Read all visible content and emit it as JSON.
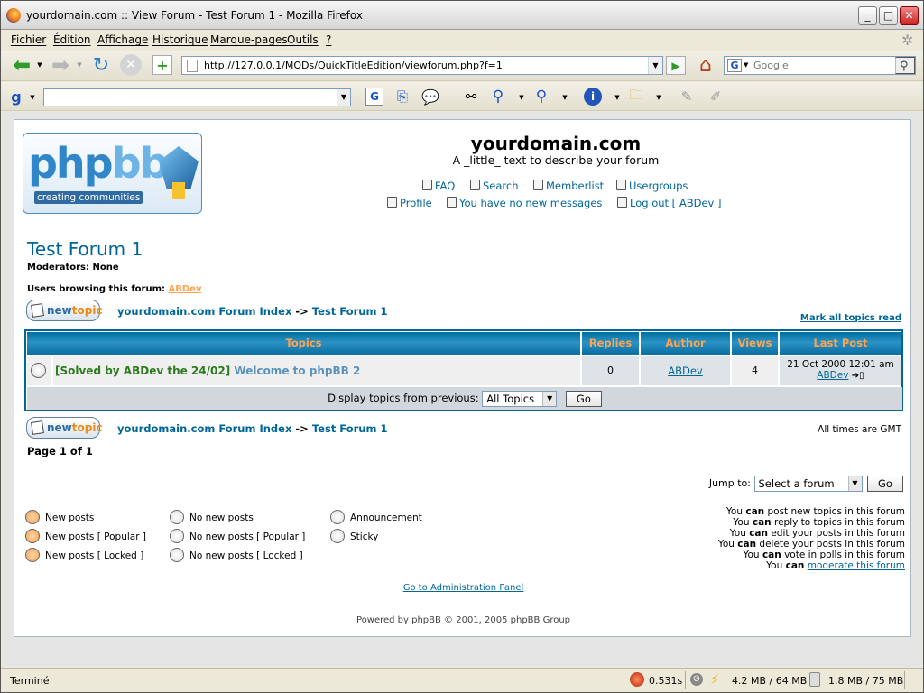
{
  "window": {
    "title": "yourdomain.com :: View Forum - Test Forum 1 - Mozilla Firefox",
    "controls": [
      "_",
      "□",
      "✕"
    ]
  },
  "menu": [
    "Fichier",
    "Édition",
    "Affichage",
    "Historique",
    "Marque-pages",
    "Outils",
    "?"
  ],
  "navbar": {
    "url": "http://127.0.0.1/MODs/QuickTitleEdition/viewforum.php?f=1",
    "search_placeholder": "Google"
  },
  "header": {
    "logo_text_dark": "php",
    "logo_text_light": "bb",
    "logo_tagline": "creating  communities",
    "site_name": "yourdomain.com",
    "site_desc": "A _little_ text to describe your forum",
    "links_row1": [
      "FAQ",
      "Search",
      "Memberlist",
      "Usergroups"
    ],
    "links_row2": [
      "Profile",
      "You have no new messages",
      "Log out [ ABDev ]"
    ]
  },
  "forum": {
    "title": "Test Forum 1",
    "moderators_label": "Moderators: None",
    "browsing_label": "Users browsing this forum:",
    "browsing_user": "ABDev",
    "newtopic_a": "new",
    "newtopic_b": "topic",
    "crumb_index": "yourdomain.com Forum Index",
    "crumb_sep": "->",
    "crumb_forum": "Test Forum 1",
    "mark_read": "Mark all topics read",
    "all_times": "All times are GMT",
    "page_info": "Page 1 of 1"
  },
  "table": {
    "headers": [
      "Topics",
      "Replies",
      "Author",
      "Views",
      "Last Post"
    ],
    "rows": [
      {
        "prefix": "[Solved by ABDev the 24/02]",
        "title": "Welcome to phpBB 2",
        "replies": "0",
        "author": "ABDev",
        "views": "4",
        "last_post_date": "21 Oct 2000 12:01 am",
        "last_post_user": "ABDev"
      }
    ],
    "display_label": "Display topics from previous:",
    "display_value": "All Topics",
    "go_label": "Go"
  },
  "jump": {
    "label": "Jump to:",
    "value": "Select a forum",
    "go": "Go"
  },
  "legend": {
    "col1": [
      "New posts",
      "New posts [ Popular ]",
      "New posts [ Locked ]"
    ],
    "col2": [
      "No new posts",
      "No new posts [ Popular ]",
      "No new posts [ Locked ]"
    ],
    "col3": [
      "Announcement",
      "Sticky"
    ]
  },
  "permissions": [
    {
      "pre": "You",
      "can": "can",
      "post": "post new topics in this forum"
    },
    {
      "pre": "You",
      "can": "can",
      "post": "reply to topics in this forum"
    },
    {
      "pre": "You",
      "can": "can",
      "post": "edit your posts in this forum"
    },
    {
      "pre": "You",
      "can": "can",
      "post": "delete your posts in this forum"
    },
    {
      "pre": "You",
      "can": "can",
      "post": "vote in polls in this forum"
    },
    {
      "pre": "You",
      "can": "can",
      "post": "moderate this forum"
    }
  ],
  "footer": {
    "admin_link": "Go to Administration Panel",
    "powered": "Powered by phpBB © 2001, 2005 phpBB Group"
  },
  "status": {
    "text": "Terminé",
    "time": "0.531s",
    "mem1": "4.2 MB / 64 MB",
    "mem2": "1.8 MB / 75 MB"
  },
  "colors": {
    "link": "#006699",
    "header_text": "#ffa34f",
    "solved": "#2c7b1e"
  }
}
